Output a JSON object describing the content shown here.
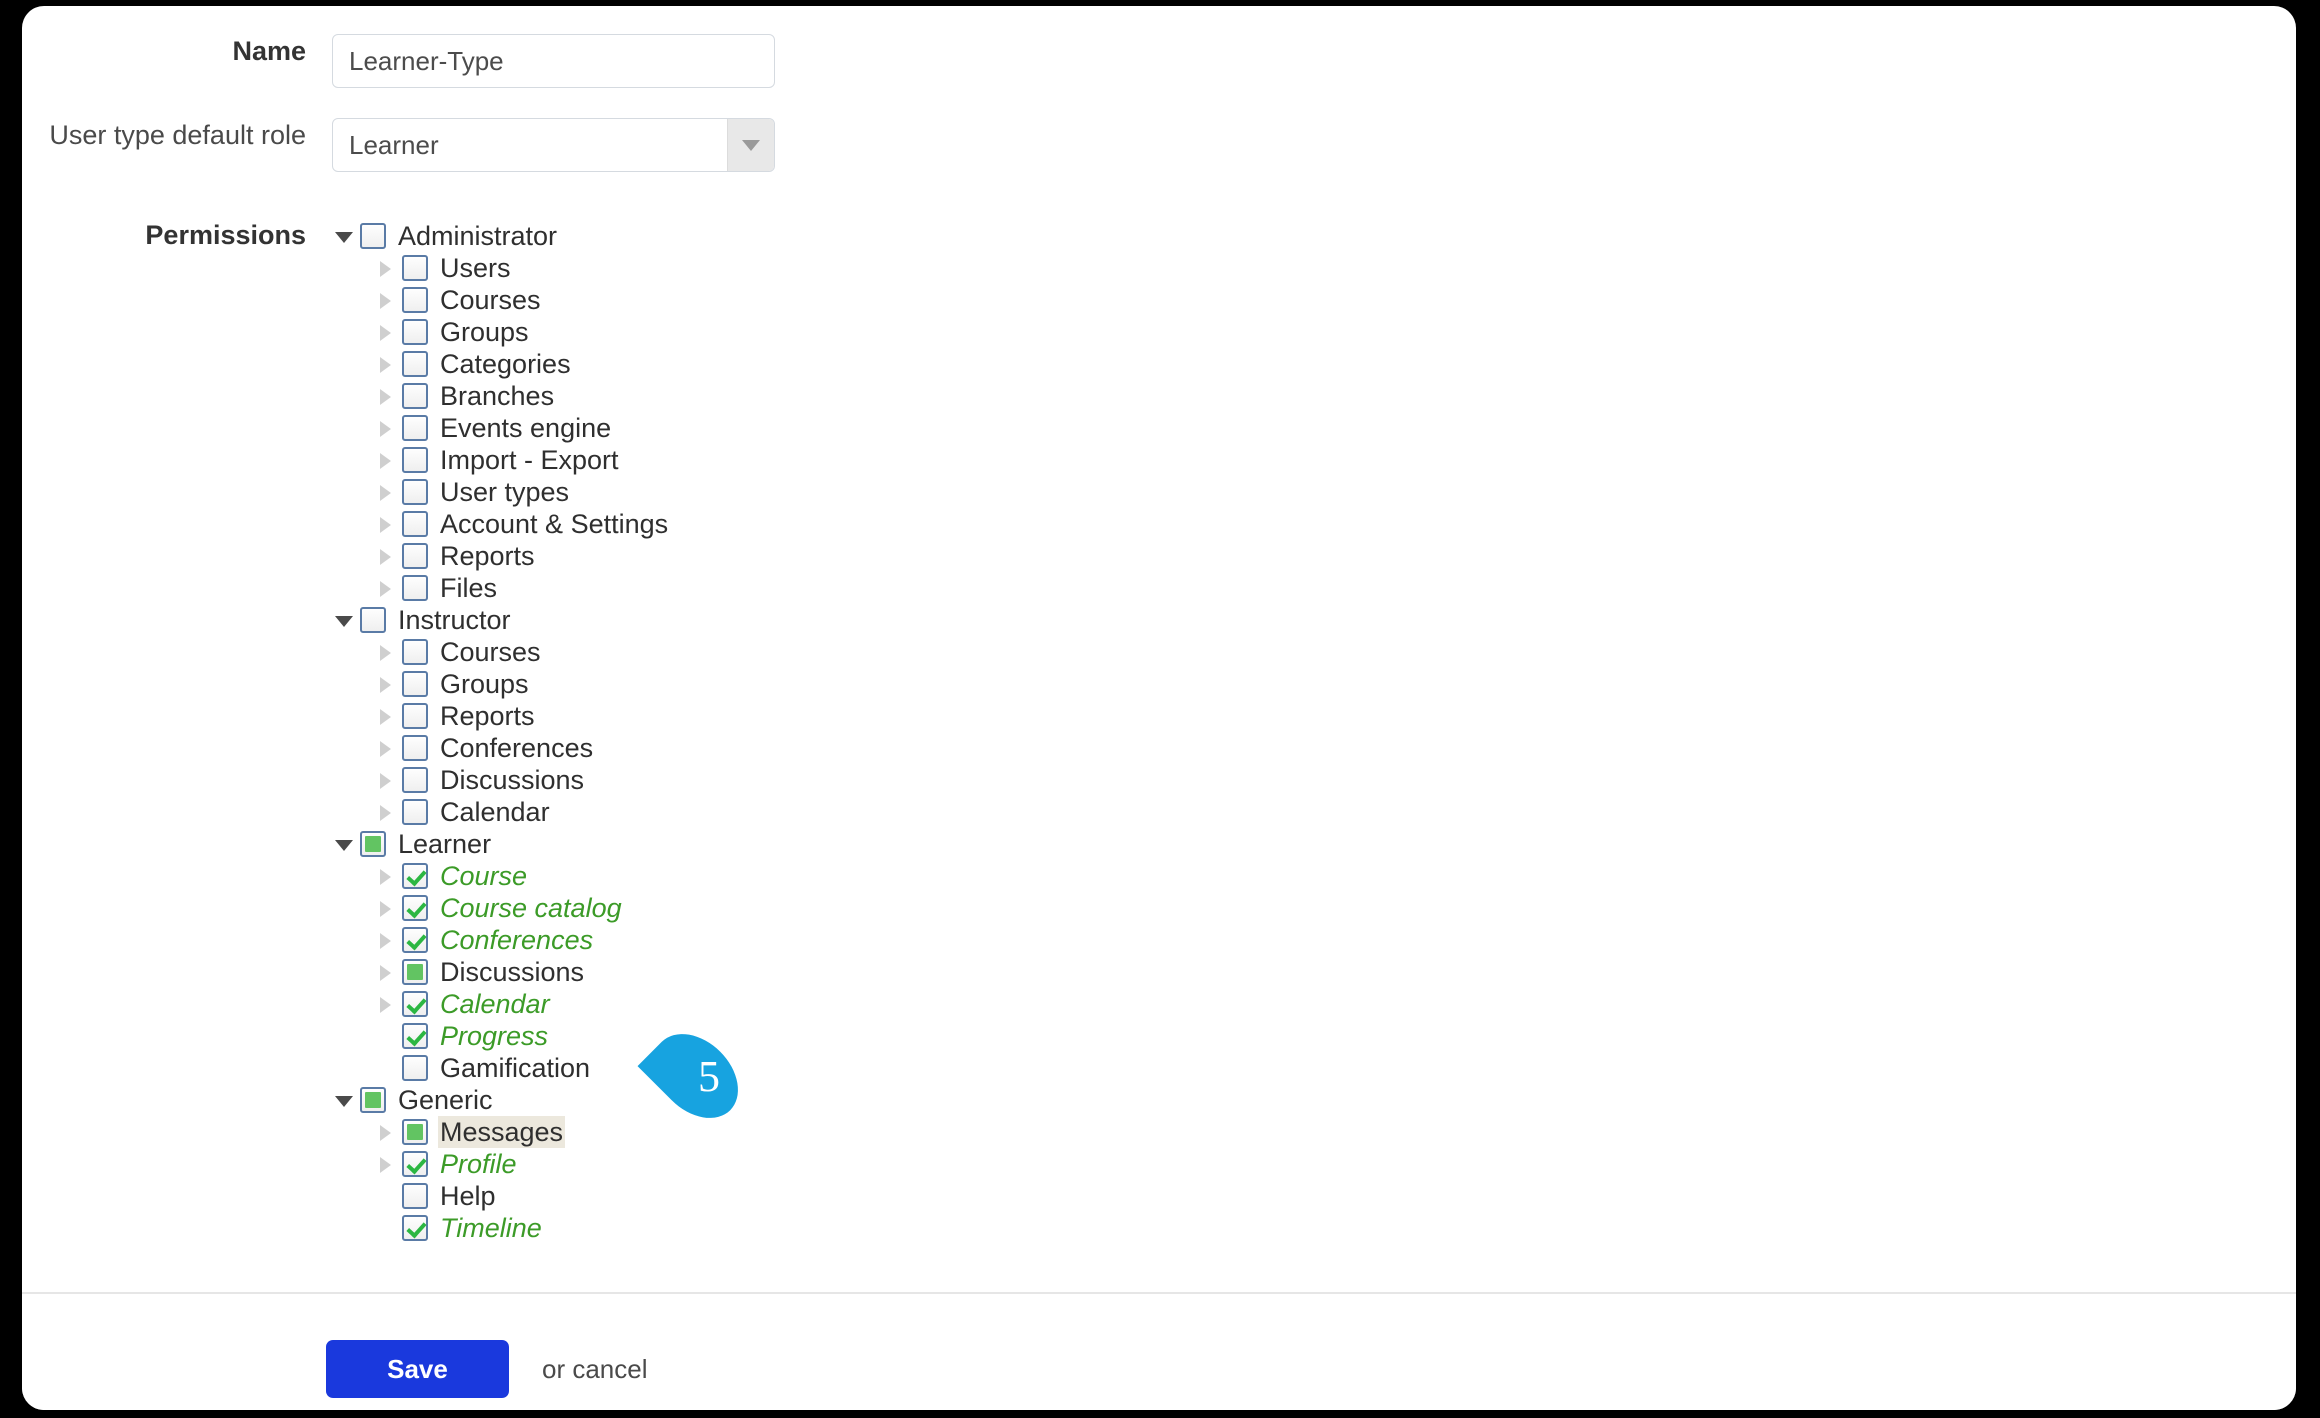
{
  "form": {
    "name_label": "Name",
    "name_value": "Learner-Type",
    "name_placeholder": "Name",
    "role_label": "User type default role",
    "role_value": "Learner",
    "permissions_label": "Permissions"
  },
  "annotation": {
    "marker_number": "5",
    "marker_color": "#17a3e0"
  },
  "footer": {
    "save_label": "Save",
    "cancel_label": "or cancel",
    "save_color": "#1a39dd"
  },
  "colors": {
    "checked_green": "#3c9b28",
    "partial_green": "#62c462",
    "checkbox_border": "#5a7ba6",
    "highlight_bg": "#ece8dd"
  },
  "tree": [
    {
      "label": "Administrator",
      "level": 0,
      "toggle": "open",
      "state": "unchecked",
      "selected": false,
      "highlight": false
    },
    {
      "label": "Users",
      "level": 1,
      "toggle": "closed",
      "state": "unchecked",
      "selected": false,
      "highlight": false
    },
    {
      "label": "Courses",
      "level": 1,
      "toggle": "closed",
      "state": "unchecked",
      "selected": false,
      "highlight": false
    },
    {
      "label": "Groups",
      "level": 1,
      "toggle": "closed",
      "state": "unchecked",
      "selected": false,
      "highlight": false
    },
    {
      "label": "Categories",
      "level": 1,
      "toggle": "closed",
      "state": "unchecked",
      "selected": false,
      "highlight": false
    },
    {
      "label": "Branches",
      "level": 1,
      "toggle": "closed",
      "state": "unchecked",
      "selected": false,
      "highlight": false
    },
    {
      "label": "Events engine",
      "level": 1,
      "toggle": "closed",
      "state": "unchecked",
      "selected": false,
      "highlight": false
    },
    {
      "label": "Import - Export",
      "level": 1,
      "toggle": "closed",
      "state": "unchecked",
      "selected": false,
      "highlight": false
    },
    {
      "label": "User types",
      "level": 1,
      "toggle": "closed",
      "state": "unchecked",
      "selected": false,
      "highlight": false
    },
    {
      "label": "Account & Settings",
      "level": 1,
      "toggle": "closed",
      "state": "unchecked",
      "selected": false,
      "highlight": false
    },
    {
      "label": "Reports",
      "level": 1,
      "toggle": "closed",
      "state": "unchecked",
      "selected": false,
      "highlight": false
    },
    {
      "label": "Files",
      "level": 1,
      "toggle": "closed",
      "state": "unchecked",
      "selected": false,
      "highlight": false
    },
    {
      "label": "Instructor",
      "level": 0,
      "toggle": "open",
      "state": "unchecked",
      "selected": false,
      "highlight": false
    },
    {
      "label": "Courses",
      "level": 1,
      "toggle": "closed",
      "state": "unchecked",
      "selected": false,
      "highlight": false
    },
    {
      "label": "Groups",
      "level": 1,
      "toggle": "closed",
      "state": "unchecked",
      "selected": false,
      "highlight": false
    },
    {
      "label": "Reports",
      "level": 1,
      "toggle": "closed",
      "state": "unchecked",
      "selected": false,
      "highlight": false
    },
    {
      "label": "Conferences",
      "level": 1,
      "toggle": "closed",
      "state": "unchecked",
      "selected": false,
      "highlight": false
    },
    {
      "label": "Discussions",
      "level": 1,
      "toggle": "closed",
      "state": "unchecked",
      "selected": false,
      "highlight": false
    },
    {
      "label": "Calendar",
      "level": 1,
      "toggle": "closed",
      "state": "unchecked",
      "selected": false,
      "highlight": false
    },
    {
      "label": "Learner",
      "level": 0,
      "toggle": "open",
      "state": "partial",
      "selected": false,
      "highlight": false
    },
    {
      "label": "Course",
      "level": 1,
      "toggle": "closed",
      "state": "checked",
      "selected": true,
      "highlight": false
    },
    {
      "label": "Course catalog",
      "level": 1,
      "toggle": "closed",
      "state": "checked",
      "selected": true,
      "highlight": false
    },
    {
      "label": "Conferences",
      "level": 1,
      "toggle": "closed",
      "state": "checked",
      "selected": true,
      "highlight": false
    },
    {
      "label": "Discussions",
      "level": 1,
      "toggle": "closed",
      "state": "partial",
      "selected": false,
      "highlight": false
    },
    {
      "label": "Calendar",
      "level": 1,
      "toggle": "closed",
      "state": "checked",
      "selected": true,
      "highlight": false
    },
    {
      "label": "Progress",
      "level": 1,
      "toggle": "none",
      "state": "checked",
      "selected": true,
      "highlight": false
    },
    {
      "label": "Gamification",
      "level": 1,
      "toggle": "none",
      "state": "unchecked",
      "selected": false,
      "highlight": false
    },
    {
      "label": "Generic",
      "level": 0,
      "toggle": "open",
      "state": "partial",
      "selected": false,
      "highlight": false
    },
    {
      "label": "Messages",
      "level": 1,
      "toggle": "closed",
      "state": "partial",
      "selected": false,
      "highlight": true
    },
    {
      "label": "Profile",
      "level": 1,
      "toggle": "closed",
      "state": "checked",
      "selected": true,
      "highlight": false
    },
    {
      "label": "Help",
      "level": 1,
      "toggle": "none",
      "state": "unchecked",
      "selected": false,
      "highlight": false
    },
    {
      "label": "Timeline",
      "level": 1,
      "toggle": "none",
      "state": "checked",
      "selected": true,
      "highlight": false
    }
  ]
}
